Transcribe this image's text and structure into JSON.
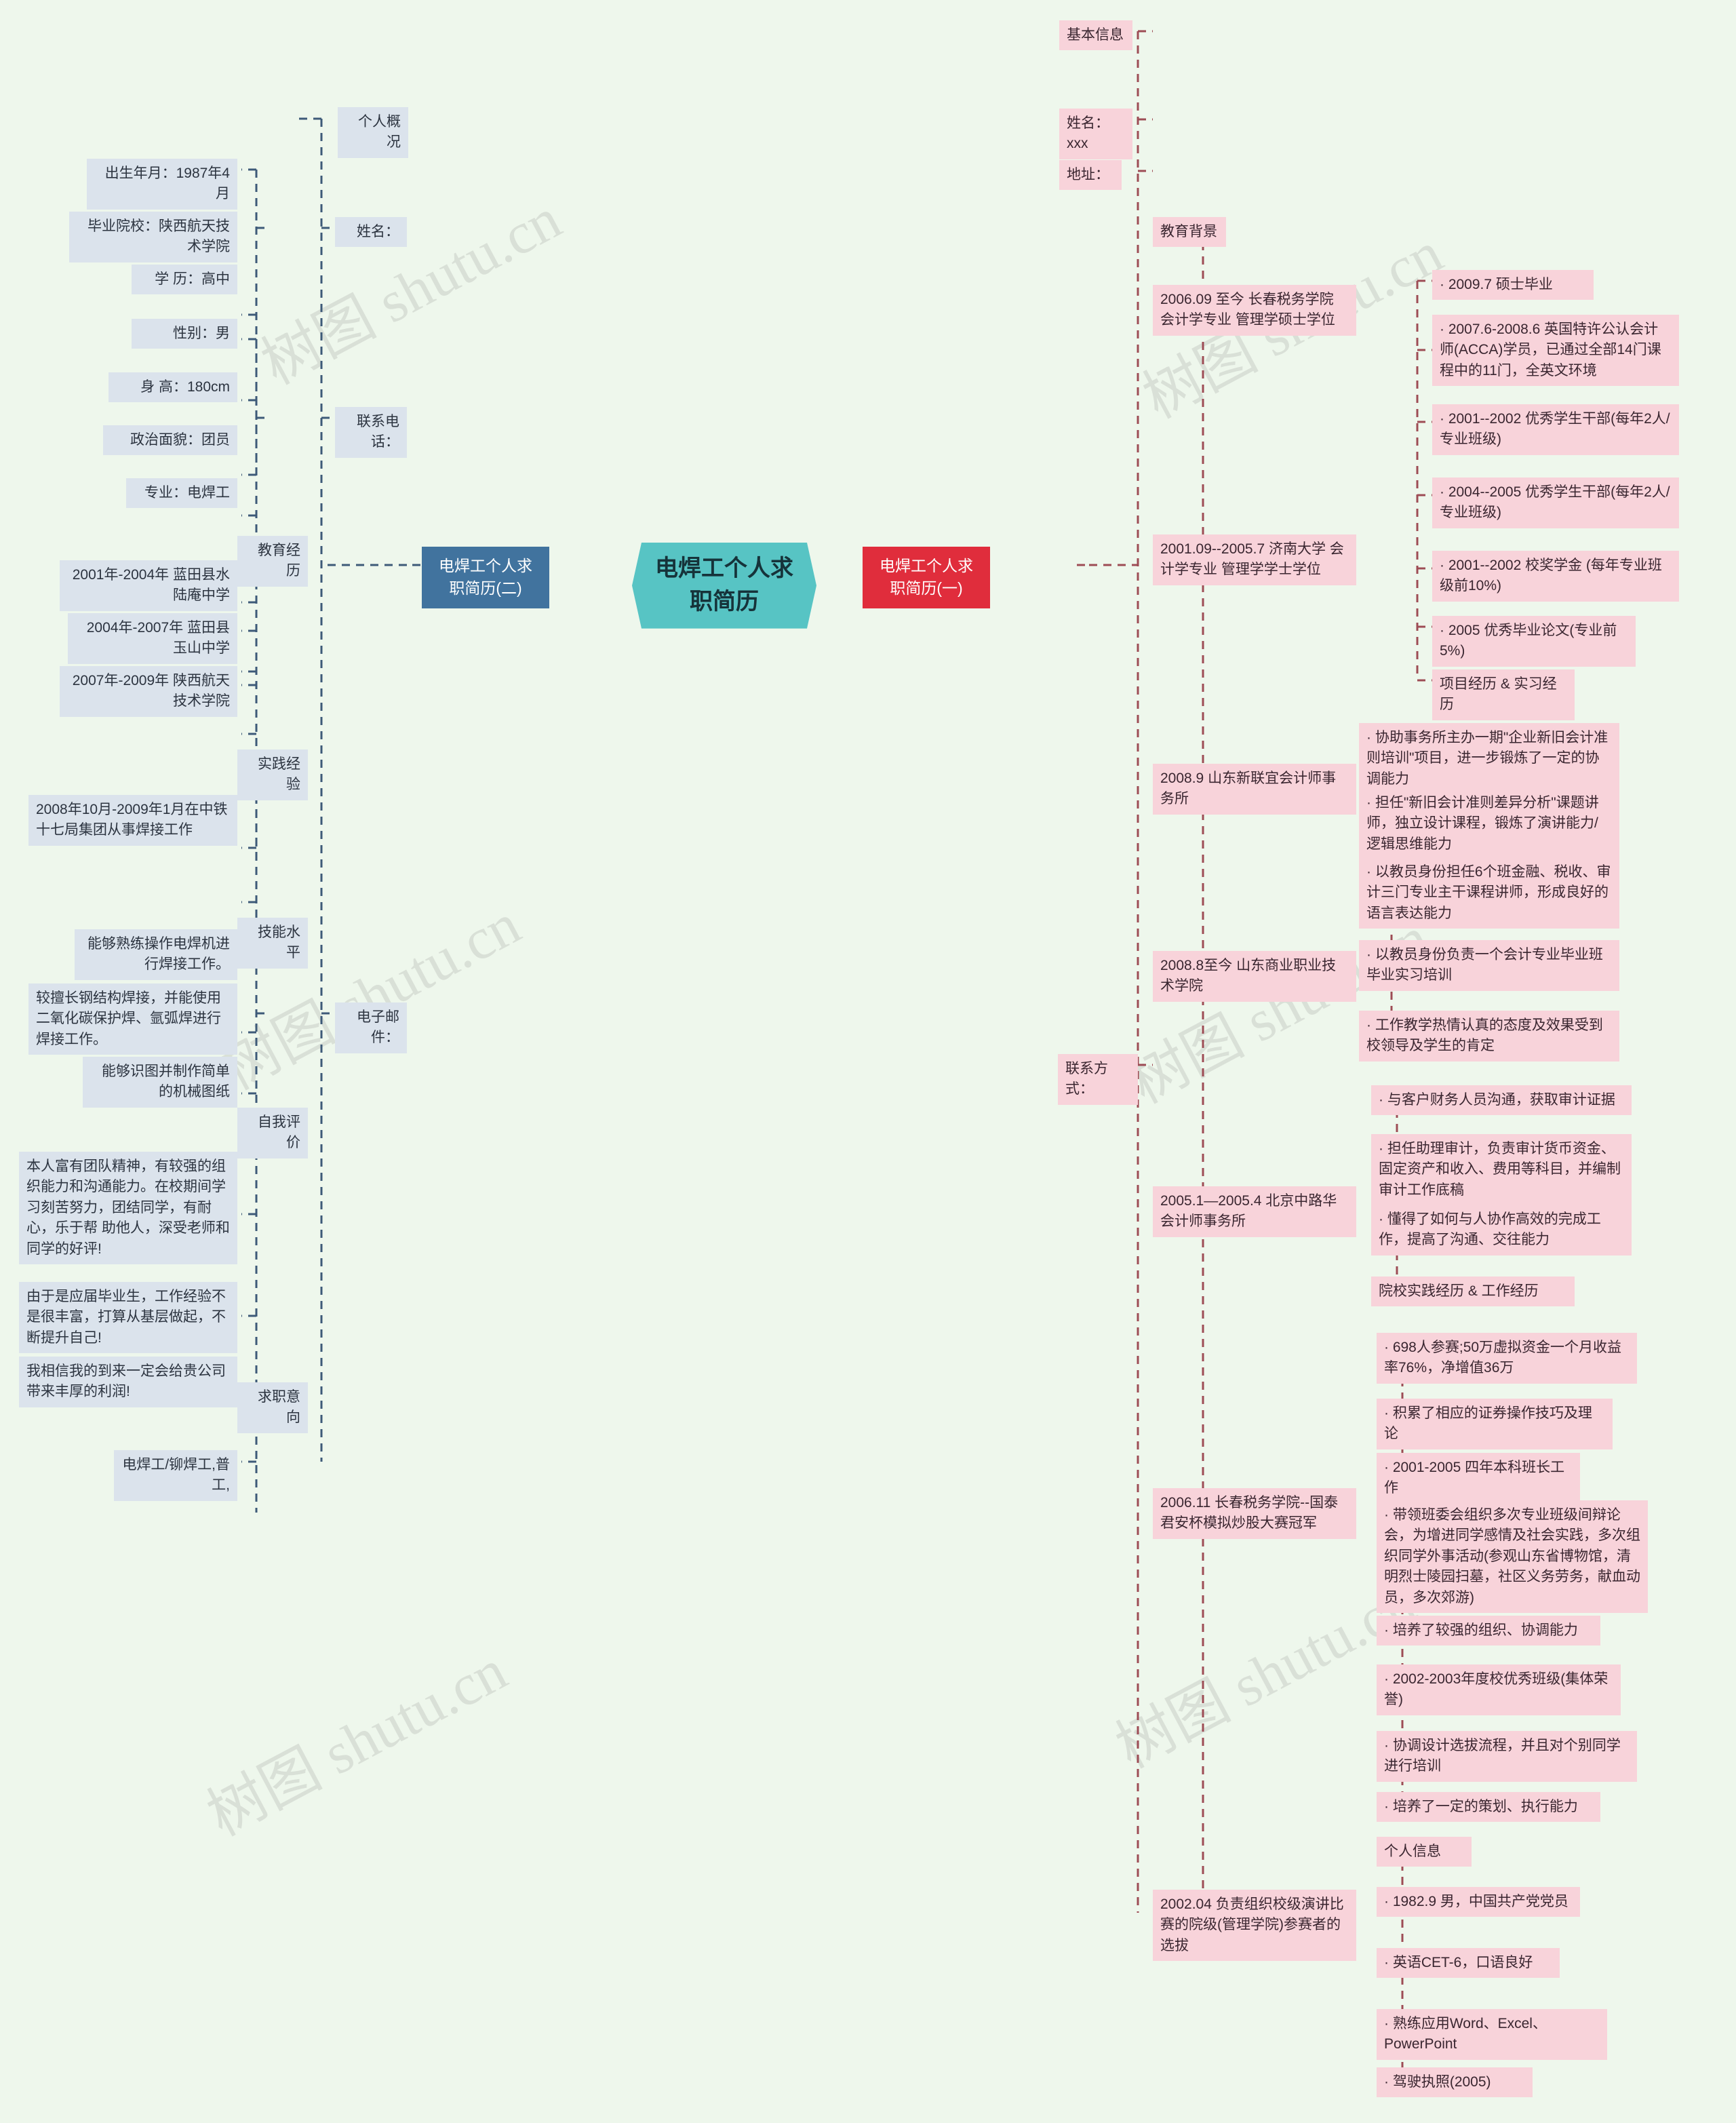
{
  "meta": {
    "background_color": "#eef7ec",
    "left_node_color": "#dbe3ec",
    "right_node_color": "#f8d3da",
    "center_node_color": "#57c4c4",
    "blue_node_color": "#41739e",
    "red_node_color": "#e02d3c",
    "left_link_color": "#3d5a78",
    "right_link_color": "#9d4c55"
  },
  "watermark": {
    "text": "树图 shutu.cn"
  },
  "center": {
    "label": "电焊工个人求职简历"
  },
  "branch_left_root": {
    "label": "电焊工个人求职简历(二)"
  },
  "branch_right_root": {
    "label": "电焊工个人求职简历(一)"
  },
  "left": {
    "l1": [
      {
        "label": "姓名："
      },
      {
        "label": "联系电话："
      },
      {
        "label": "电子邮件："
      }
    ],
    "l2": [
      {
        "label": "个人概况"
      },
      {
        "label": "教育经历"
      },
      {
        "label": "实践经验"
      },
      {
        "label": "技能水平"
      },
      {
        "label": "自我评价"
      },
      {
        "label": "求职意向"
      }
    ],
    "l3": [
      {
        "label": "出生年月：1987年4月"
      },
      {
        "label": "毕业院校：陕西航天技术学院"
      },
      {
        "label": "学 历：高中"
      },
      {
        "label": "性别：男"
      },
      {
        "label": "身 高：180cm"
      },
      {
        "label": "政治面貌：团员"
      },
      {
        "label": "专业：电焊工"
      },
      {
        "label": "2001年-2004年 蓝田县水陆庵中学"
      },
      {
        "label": "2004年-2007年 蓝田县玉山中学"
      },
      {
        "label": "2007年-2009年 陕西航天技术学院"
      },
      {
        "label": "2008年10月-2009年1月在中铁十七局集团从事焊接工作"
      },
      {
        "label": "能够熟练操作电焊机进行焊接工作。"
      },
      {
        "label": "较擅长钢结构焊接，并能使用二氧化碳保护焊、氩弧焊进行焊接工作。"
      },
      {
        "label": "能够识图并制作简单的机械图纸"
      },
      {
        "label": "本人富有团队精神，有较强的组织能力和沟通能力。在校期间学习刻苦努力，团结同学，有耐心，乐于帮 助他人，深受老师和同学的好评!"
      },
      {
        "label": "由于是应届毕业生，工作经验不是很丰富，打算从基层做起，不断提升自己!"
      },
      {
        "label": "我相信我的到来一定会给贵公司带来丰厚的利润!"
      },
      {
        "label": "电焊工/铆焊工,普工,"
      }
    ]
  },
  "right": {
    "l1": [
      {
        "label": "基本信息"
      },
      {
        "label": "姓名：xxx"
      },
      {
        "label": "地址："
      },
      {
        "label": "联系方式："
      }
    ],
    "l2": [
      {
        "label": "教育背景"
      },
      {
        "label": "2006.09 至今 长春税务学院 会计学专业 管理学硕士学位"
      },
      {
        "label": "2001.09--2005.7 济南大学 会计学专业 管理学学士学位"
      },
      {
        "label": "2008.9 山东新联宜会计师事务所"
      },
      {
        "label": "2008.8至今 山东商业职业技术学院"
      },
      {
        "label": "2005.1—2005.4 北京中路华会计师事务所"
      },
      {
        "label": "2006.11 长春税务学院--国泰君安杯模拟炒股大赛冠军"
      },
      {
        "label": "2002.04 负责组织校级演讲比赛的院级(管理学院)参赛者的选拔"
      }
    ],
    "l3": [
      {
        "label": "· 2009.7 硕士毕业"
      },
      {
        "label": "· 2007.6-2008.6 英国特许公认会计师(ACCA)学员，已通过全部14门课程中的11门，全英文环境"
      },
      {
        "label": "· 2001--2002 优秀学生干部(每年2人/专业班级)"
      },
      {
        "label": "· 2004--2005 优秀学生干部(每年2人/专业班级)"
      },
      {
        "label": "· 2001--2002 校奖学金 (每年专业班级前10%)"
      },
      {
        "label": "· 2005 优秀毕业论文(专业前5%)"
      },
      {
        "label": "项目经历 & 实习经历"
      },
      {
        "label": "· 协助事务所主办一期\"企业新旧会计准则培训\"项目，进一步锻炼了一定的协调能力"
      },
      {
        "label": "· 担任\"新旧会计准则差异分析\"课题讲师，独立设计课程，锻炼了演讲能力/逻辑思维能力"
      },
      {
        "label": "· 以教员身份担任6个班金融、税收、审计三门专业主干课程讲师，形成良好的语言表达能力"
      },
      {
        "label": "· 以教员身份负责一个会计专业毕业班毕业实习培训"
      },
      {
        "label": "· 工作教学热情认真的态度及效果受到校领导及学生的肯定"
      },
      {
        "label": "· 与客户财务人员沟通，获取审计证据"
      },
      {
        "label": "· 担任助理审计，负责审计货币资金、固定资产和收入、费用等科目，并编制审计工作底稿"
      },
      {
        "label": "· 懂得了如何与人协作高效的完成工作，提高了沟通、交往能力"
      },
      {
        "label": "院校实践经历 & 工作经历"
      },
      {
        "label": "· 698人参赛;50万虚拟资金一个月收益率76%，净增值36万"
      },
      {
        "label": "· 积累了相应的证券操作技巧及理论"
      },
      {
        "label": "· 2001-2005 四年本科班长工作"
      },
      {
        "label": "· 带领班委会组织多次专业班级间辩论会，为增进同学感情及社会实践，多次组织同学外事活动(参观山东省博物馆，清明烈士陵园扫墓，社区义务劳务，献血动员，多次郊游)"
      },
      {
        "label": "· 培养了较强的组织、协调能力"
      },
      {
        "label": "· 2002-2003年度校优秀班级(集体荣誉)"
      },
      {
        "label": "· 协调设计选拔流程，并且对个别同学进行培训"
      },
      {
        "label": "· 培养了一定的策划、执行能力"
      },
      {
        "label": "个人信息"
      },
      {
        "label": "· 1982.9 男，中国共产党党员"
      },
      {
        "label": "· 英语CET-6，口语良好"
      },
      {
        "label": "· 熟练应用Word、Excel、PowerPoint"
      },
      {
        "label": "· 驾驶执照(2005)"
      }
    ]
  }
}
